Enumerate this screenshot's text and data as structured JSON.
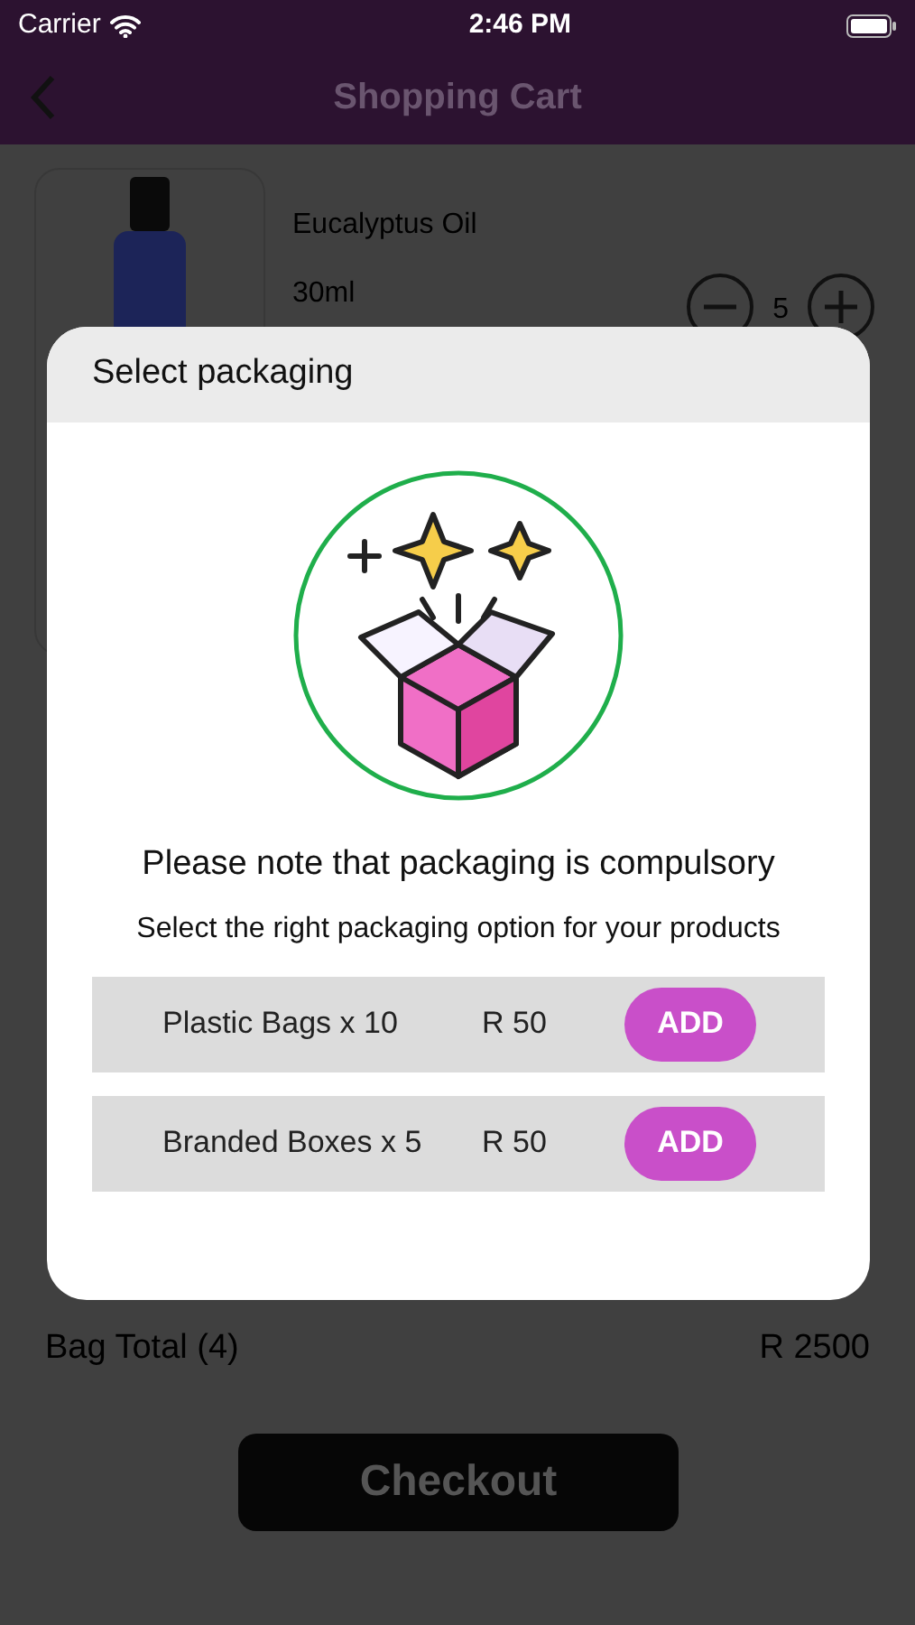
{
  "status_bar": {
    "carrier": "Carrier",
    "time": "2:46 PM"
  },
  "nav": {
    "title": "Shopping Cart"
  },
  "cart_item": {
    "name": "Eucalyptus Oil",
    "size": "30ml",
    "quantity": "5"
  },
  "summary": {
    "label": "Bag Total (4)",
    "value": "R 2500"
  },
  "checkout": "Checkout",
  "dialog": {
    "title": "Select packaging",
    "note": "Please note that packaging is compulsory",
    "subtitle": "Select the right packaging option for your products",
    "options": [
      {
        "label": "Plastic Bags x 10",
        "price": "R 50",
        "button": "ADD"
      },
      {
        "label": "Branded Boxes x 5",
        "price": "R 50",
        "button": "ADD"
      }
    ]
  }
}
